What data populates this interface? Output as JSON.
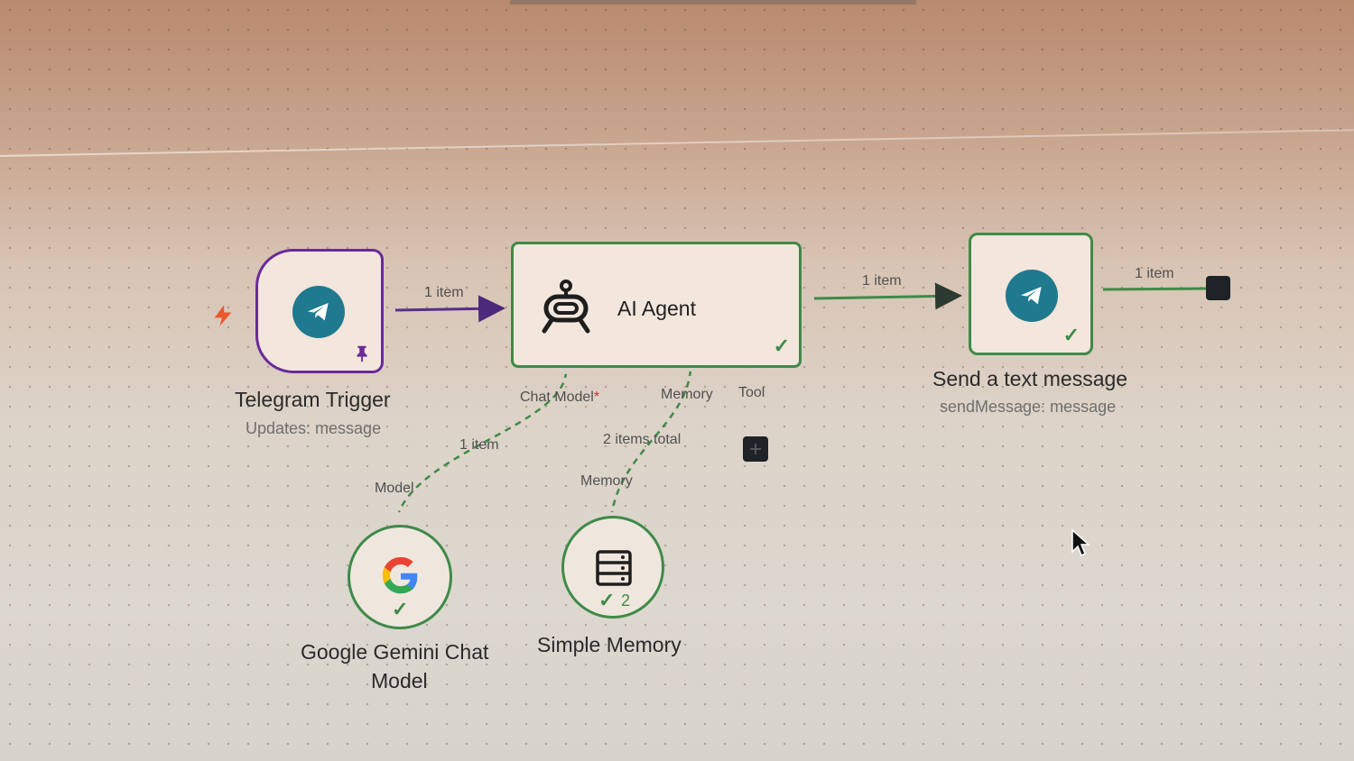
{
  "canvas": {
    "background": "#d8cfc6"
  },
  "nodes": {
    "telegram_trigger": {
      "title": "Telegram Trigger",
      "subtitle": "Updates: message",
      "border_color": "#6a2a9a",
      "icon": "telegram-icon",
      "pin_icon": "pin-icon",
      "trigger_icon": "lightning-icon"
    },
    "ai_agent": {
      "title": "AI Agent",
      "icon": "robot-icon",
      "status_icon": "check-icon",
      "ports": {
        "chat_model": "Chat Model",
        "chat_model_required": "*",
        "memory": "Memory",
        "tool": "Tool"
      }
    },
    "send_message": {
      "title": "Send a text message",
      "subtitle": "sendMessage: message",
      "icon": "telegram-icon",
      "status_icon": "check-icon"
    },
    "gemini": {
      "title_line1": "Google Gemini Chat",
      "title_line2": "Model",
      "port_label": "Model",
      "icon": "google-g-icon",
      "status_icon": "check-icon"
    },
    "memory": {
      "title": "Simple Memory",
      "port_label": "Memory",
      "icon": "database-icon",
      "run_count": "2",
      "status_icon": "check-icon"
    }
  },
  "connections": {
    "trigger_to_agent": "1 item",
    "agent_to_send": "1 item",
    "send_output": "1 item",
    "gemini_to_agent": "1 item",
    "memory_to_agent": "2 items total"
  },
  "colors": {
    "trigger_accent": "#6a2a9a",
    "success_green": "#3f8a48",
    "telegram_blue": "#1f7a8f",
    "lightning_orange": "#e8582a"
  }
}
